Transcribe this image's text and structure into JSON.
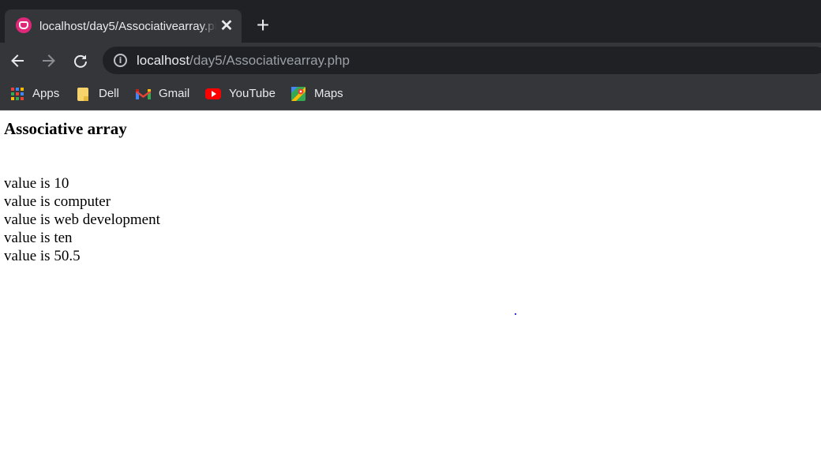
{
  "browser": {
    "tab": {
      "title": "localhost/day5/Associativearray.php",
      "favicon": "xampp-icon",
      "close_glyph": "✕"
    },
    "new_tab_glyph": "+",
    "toolbar": {
      "back_icon": "back-arrow-icon",
      "forward_icon": "forward-arrow-icon",
      "reload_icon": "reload-icon",
      "info_glyph": "i",
      "url_host": "localhost",
      "url_path": "/day5/Associativearray.php"
    },
    "bookmarks": [
      {
        "label": "Apps",
        "icon": "apps-grid-icon"
      },
      {
        "label": "Dell",
        "icon": "folder-icon"
      },
      {
        "label": "Gmail",
        "icon": "gmail-icon"
      },
      {
        "label": "YouTube",
        "icon": "youtube-icon"
      },
      {
        "label": "Maps",
        "icon": "maps-icon"
      }
    ]
  },
  "page": {
    "heading": "Associative array",
    "lines": [
      "value is 10",
      "value is computer",
      "value is web development",
      "value is ten",
      "value is 50.5"
    ]
  },
  "colors": {
    "tabstrip_bg": "#202124",
    "toolbar_bg": "#35363a",
    "omnibox_bg": "#202124",
    "favicon": "#e0287a",
    "page_bg": "#ffffff"
  }
}
